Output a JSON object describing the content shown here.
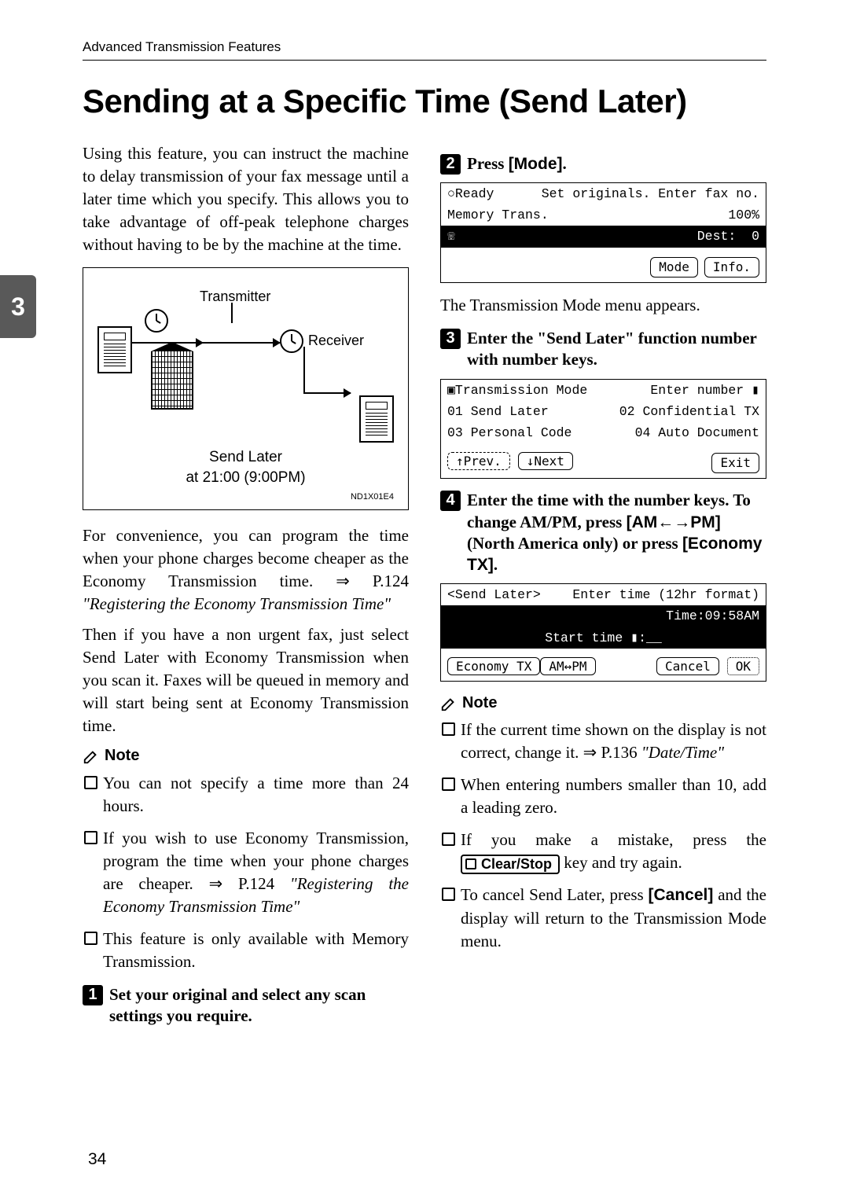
{
  "running_head": "Advanced Transmission Features",
  "title": "Sending at a Specific Time (Send Later)",
  "page_number": "34",
  "tab_number": "3",
  "left": {
    "intro": "Using this feature, you can instruct the machine to delay transmission of your fax message until a later time which you specify. This allows you to take advantage of off-peak telephone charges without having to be by the machine at the time.",
    "fig": {
      "transmitter": "Transmitter",
      "receiver": "Receiver",
      "caption1": "Send Later",
      "caption2": "at 21:00 (9:00PM)",
      "id": "ND1X01E4"
    },
    "para2a": "For convenience, you can program the time when your phone charges become cheaper as the Economy Transmission time. ⇒ P.124 ",
    "para2b": "\"Registering the Economy Transmission Time\"",
    "para3": "Then if you have a non urgent fax, just select Send Later with Economy Transmission when you scan it. Faxes will be queued in memory and will start being sent at Economy Transmission time.",
    "note_label": "Note",
    "notes": {
      "n1": "You can not specify a time more than 24 hours.",
      "n2a": "If you wish to use Economy Transmission, program the time when your phone charges are cheaper. ⇒ P.124 ",
      "n2b": "\"Registering the Economy Transmission Time\"",
      "n3": "This feature is only available with Memory Transmission."
    },
    "step1": {
      "n": "1",
      "text_a": "Set your original and select any scan settings you require."
    }
  },
  "right": {
    "step2": {
      "n": "2",
      "pre": "Press ",
      "btn": "[Mode]",
      "post": "."
    },
    "lcd2": {
      "r1l": "○Ready",
      "r1r": "Set originals. Enter fax no.",
      "r2l": "Memory Trans.",
      "r2r": "100%",
      "r3l": "☏",
      "r3r": "Dest:  0",
      "b1": "Mode",
      "b2": "Info."
    },
    "after2": "The Transmission Mode menu appears.",
    "step3": {
      "n": "3",
      "text": "Enter the \"Send Later\" function number with number keys."
    },
    "lcd3": {
      "r1l": "▣Transmission Mode",
      "r1r": "Enter number ▮",
      "r2l": "01 Send Later",
      "r2r": "02 Confidential TX",
      "r3l": "03 Personal Code",
      "r3r": "04 Auto Document",
      "b1": "↑Prev.",
      "b2": "↓Next",
      "b3": "Exit"
    },
    "step4": {
      "n": "4",
      "l1": "Enter the time with the number keys. To change AM/PM, press ",
      "l2": "[AM←→PM]",
      "l3": " (North America only) or press ",
      "l4": "[Economy TX]",
      "l5": "."
    },
    "lcd4": {
      "r1l": "<Send Later>",
      "r1r": "Enter time (12hr format)",
      "r2r": "Time:09:58AM",
      "r3": "Start time ▮:__",
      "b1": "Economy TX",
      "b2": "AM↔PM",
      "b3": "Cancel",
      "b4": "OK"
    },
    "note_label": "Note",
    "notes": {
      "n1a": "If the current time shown on the display is not correct, change it. ⇒ P.136 ",
      "n1b": "\"Date/Time\"",
      "n2": "When entering numbers smaller than 10, add a leading zero.",
      "n3a": "If you make a mistake, press the ",
      "n3b": "Clear/Stop",
      "n3c": " key and try again.",
      "n4a": "To cancel Send Later, press ",
      "n4b": "[Cancel]",
      "n4c": " and the display will return to the Transmission Mode menu."
    }
  }
}
